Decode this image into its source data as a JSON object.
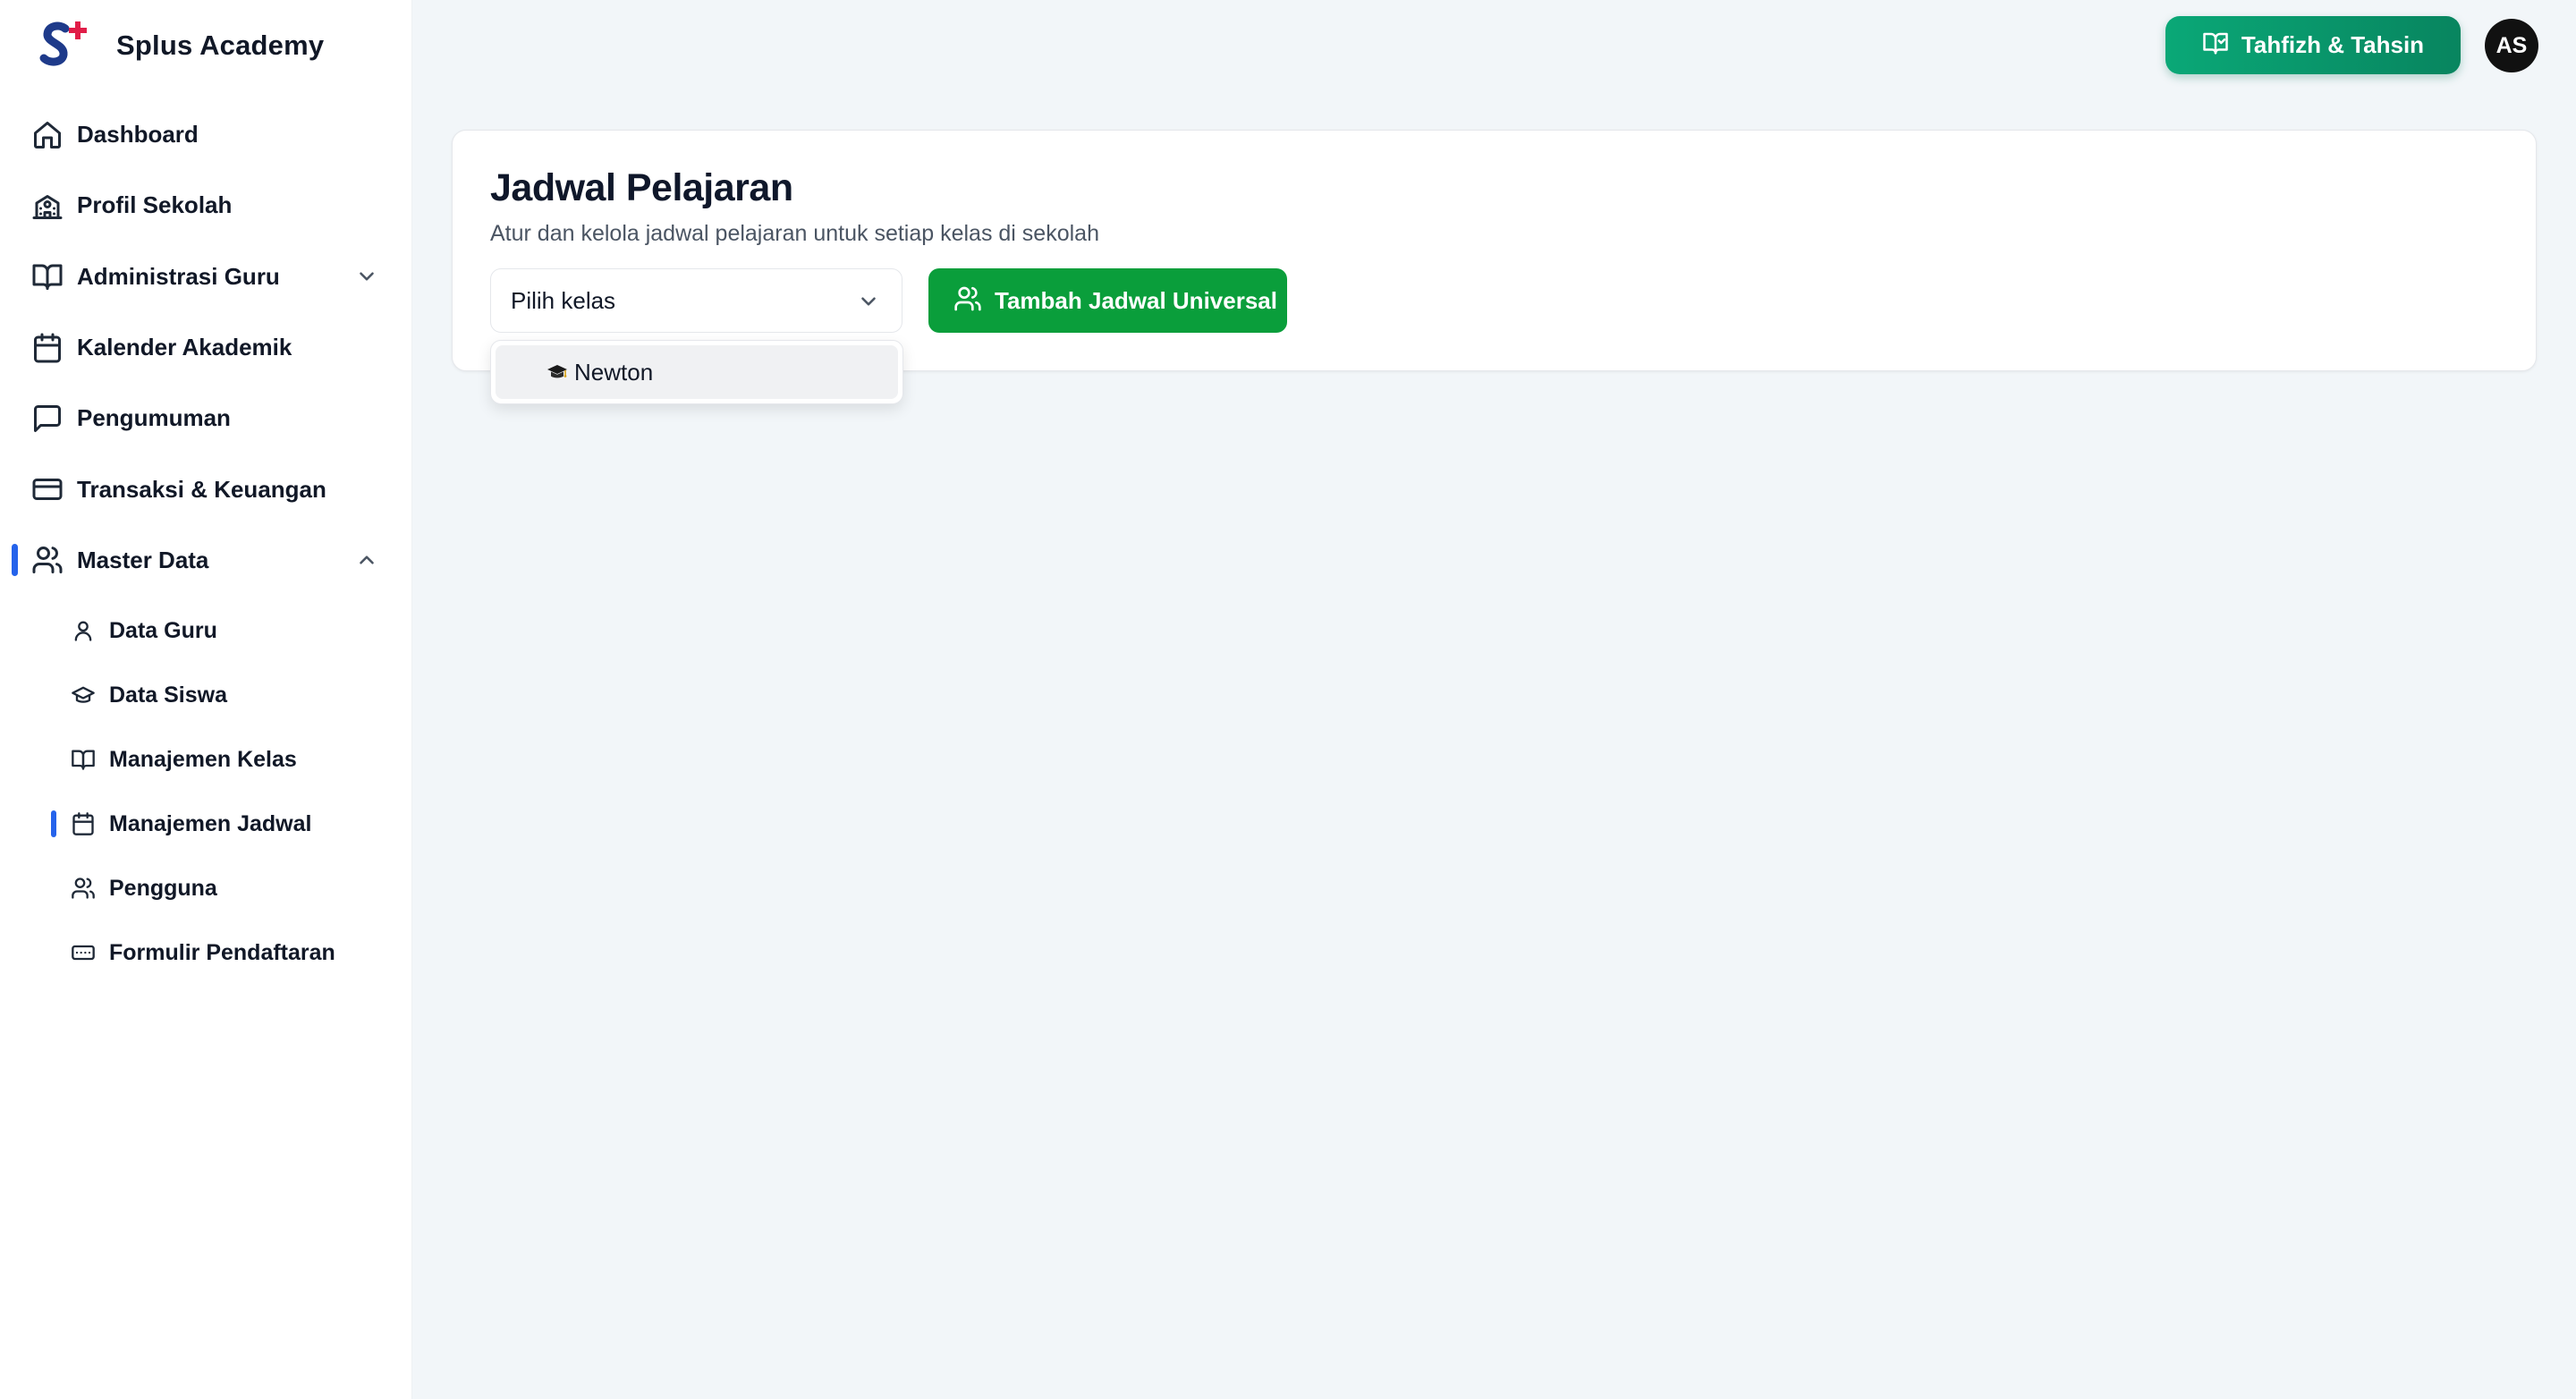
{
  "app": {
    "name": "Splus Academy",
    "logo_icon": "splus-logo-icon",
    "brand_colors": {
      "logo_s": "#1e3a8a",
      "logo_plus": "#e11d48"
    }
  },
  "sidebar": {
    "items": [
      {
        "label": "Dashboard",
        "icon": "home-icon"
      },
      {
        "label": "Profil Sekolah",
        "icon": "school-icon"
      },
      {
        "label": "Administrasi Guru",
        "icon": "book-open-icon",
        "expandable": true,
        "expanded": false
      },
      {
        "label": "Kalender Akademik",
        "icon": "calendar-icon"
      },
      {
        "label": "Pengumuman",
        "icon": "message-square-icon"
      },
      {
        "label": "Transaksi & Keuangan",
        "icon": "credit-card-icon"
      },
      {
        "label": "Master Data",
        "icon": "users-icon",
        "expandable": true,
        "expanded": true,
        "active": true
      }
    ],
    "sub_items": [
      {
        "label": "Data Guru",
        "icon": "user-icon"
      },
      {
        "label": "Data Siswa",
        "icon": "graduation-cap-icon"
      },
      {
        "label": "Manajemen Kelas",
        "icon": "book-open-icon"
      },
      {
        "label": "Manajemen Jadwal",
        "icon": "calendar-icon",
        "active": true
      },
      {
        "label": "Pengguna",
        "icon": "users-icon"
      },
      {
        "label": "Formulir Pendaftaran",
        "icon": "form-input-icon"
      }
    ],
    "active_indicator_color": "#2563eb"
  },
  "header": {
    "module_button_label": "Tahfizh & Tahsin",
    "module_button_icon": "book-open-check-icon",
    "module_button_color": "#0a9a6c",
    "avatar_initials": "AS"
  },
  "main": {
    "title": "Jadwal Pelajaran",
    "subtitle": "Atur dan kelola jadwal pelajaran untuk setiap kelas di sekolah",
    "class_select": {
      "placeholder": "Pilih kelas",
      "options": [
        {
          "label": "Newton",
          "icon": "graduation-cap-emoji"
        }
      ]
    },
    "add_button_label": "Tambah Jadwal Universal",
    "add_button_icon": "users-icon",
    "add_button_color": "#0a9e3b"
  }
}
